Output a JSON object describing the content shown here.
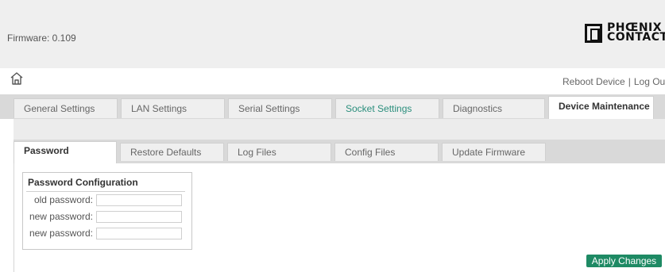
{
  "header": {
    "firmware_text": "Firmware: 0.109",
    "logo": {
      "line1": "PHŒNIX",
      "line2": "CONTACT"
    }
  },
  "nav": {
    "home_icon": "home-icon",
    "reboot_label": "Reboot Device",
    "separator": "|",
    "logout_label": "Log Out"
  },
  "main_tabs": [
    {
      "label": "General Settings"
    },
    {
      "label": "LAN Settings"
    },
    {
      "label": "Serial Settings"
    },
    {
      "label": "Socket Settings",
      "color": "#2a8e7c"
    },
    {
      "label": "Diagnostics"
    },
    {
      "label": "Device Maintenance",
      "active": true
    }
  ],
  "sub_tabs": [
    {
      "label": "Password",
      "active": true
    },
    {
      "label": "Restore Defaults"
    },
    {
      "label": "Log Files"
    },
    {
      "label": "Config Files"
    },
    {
      "label": "Update Firmware"
    }
  ],
  "password_config": {
    "title": "Password Configuration",
    "rows": [
      {
        "label": "old password:",
        "value": ""
      },
      {
        "label": "new password:",
        "value": ""
      },
      {
        "label": "new password:",
        "value": ""
      }
    ]
  },
  "actions": {
    "apply_label": "Apply Changes",
    "apply_color": "#1e8a64"
  }
}
